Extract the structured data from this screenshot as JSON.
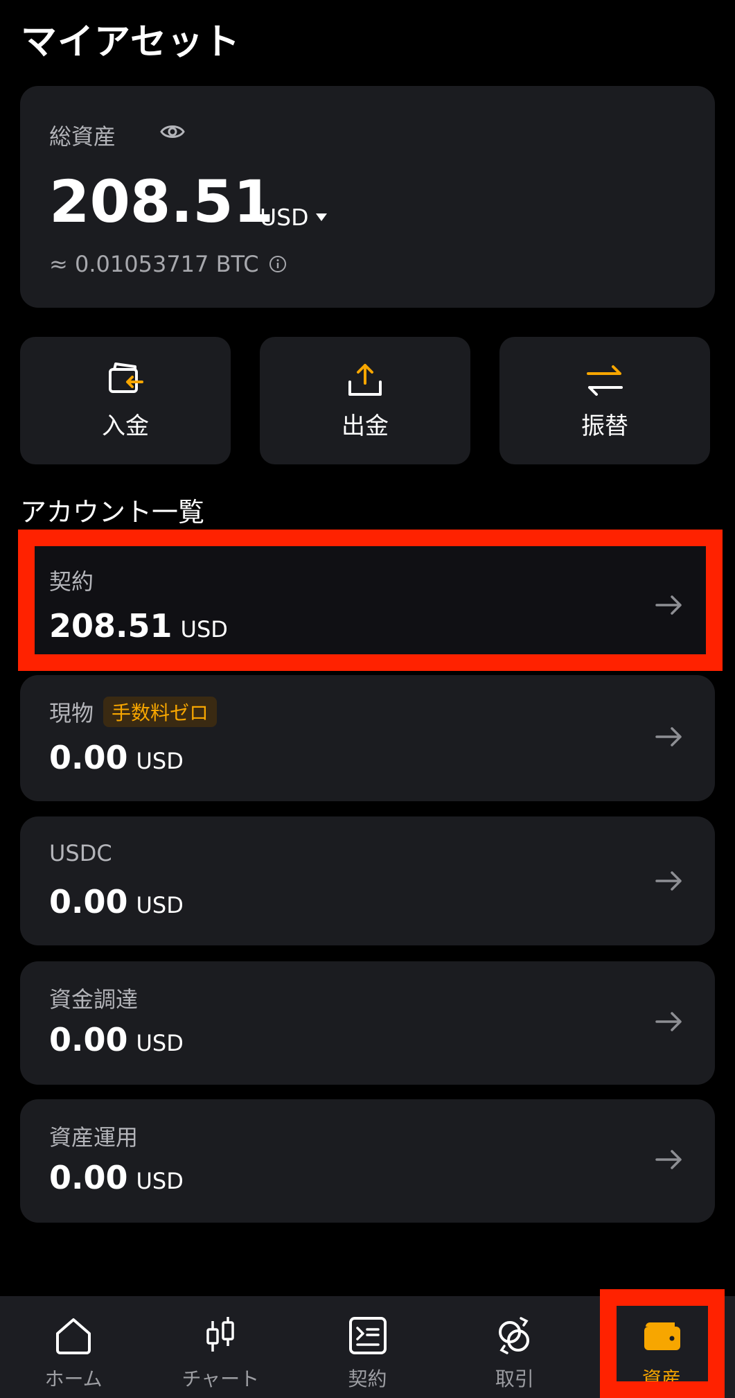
{
  "header": {
    "title": "マイアセット"
  },
  "total": {
    "label": "総資産",
    "amount": "208.51",
    "currency": "USD",
    "btc_equivalent": "≈ 0.01053717 BTC"
  },
  "actions": [
    {
      "label": "入金",
      "icon": "deposit-icon"
    },
    {
      "label": "出金",
      "icon": "withdraw-icon"
    },
    {
      "label": "振替",
      "icon": "transfer-icon"
    }
  ],
  "accounts_section": {
    "title": "アカウント一覧",
    "items": [
      {
        "name": "契約",
        "balance": "208.51",
        "currency": "USD"
      },
      {
        "name": "現物",
        "badge": "手数料ゼロ",
        "balance": "0.00",
        "currency": "USD"
      },
      {
        "name": "USDC",
        "balance": "0.00",
        "currency": "USD"
      },
      {
        "name": "資金調達",
        "balance": "0.00",
        "currency": "USD"
      },
      {
        "name": "資産運用",
        "balance": "0.00",
        "currency": "USD"
      }
    ]
  },
  "tabbar": {
    "items": [
      {
        "label": "ホーム",
        "icon": "home-icon"
      },
      {
        "label": "チャート",
        "icon": "candlestick-chart-icon"
      },
      {
        "label": "契約",
        "icon": "contract-icon"
      },
      {
        "label": "取引",
        "icon": "trade-icon"
      },
      {
        "label": "資産",
        "icon": "wallet-icon",
        "active": true
      }
    ]
  },
  "colors": {
    "accent": "#f7a600",
    "highlight": "#ff2200",
    "card": "#1b1c20"
  }
}
